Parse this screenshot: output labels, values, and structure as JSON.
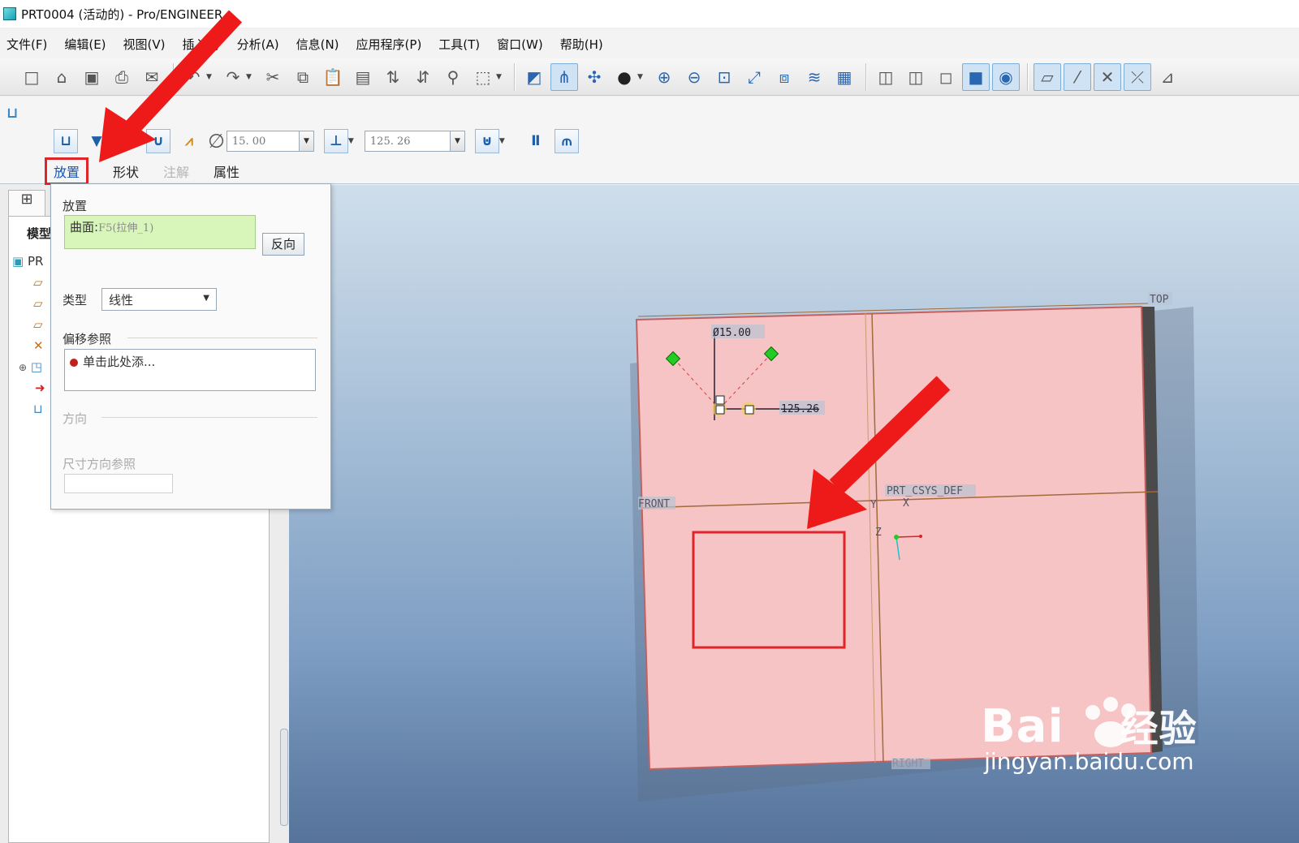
{
  "window": {
    "title": "PRT0004 (活动的) - Pro/ENGINEER"
  },
  "menu": [
    "文件(F)",
    "编辑(E)",
    "视图(V)",
    "插入(I)",
    "分析(A)",
    "信息(N)",
    "应用程序(P)",
    "工具(T)",
    "窗口(W)",
    "帮助(H)"
  ],
  "toolbar": {
    "icons": [
      "new-icon",
      "open-icon",
      "save-icon",
      "print-icon",
      "send-icon",
      "undo-icon",
      "redo-icon",
      "cut-icon",
      "copy-icon",
      "paste-icon",
      "paste-special-icon",
      "regenerate-icon",
      "regen-manager-icon",
      "find-icon",
      "select-box-icon",
      "sketch-display-icon",
      "datum-axis-icon",
      "datum-point-icon",
      "shading-icon",
      "zoom-in-icon",
      "zoom-out-icon",
      "refit-icon",
      "reorient-icon",
      "saved-views-icon",
      "layers-icon",
      "view-manager-icon",
      "wireframe-icon",
      "hidden-line-icon",
      "no-hidden-icon",
      "shaded-icon",
      "enhanced-realism-icon",
      "datum-planes-icon",
      "datum-axes-icon",
      "point-display-icon",
      "csys-display-icon",
      "annotation-display-icon"
    ]
  },
  "dashboard": {
    "diameter": "15. 00",
    "depth": "125. 26",
    "tabs": {
      "placement": "放置",
      "shape": "形状",
      "note": "注解",
      "properties": "属性"
    }
  },
  "placement_panel": {
    "title": "放置",
    "surface_label": "曲面:",
    "surface_ref": "F5(拉伸_1)",
    "flip_button": "反向",
    "type_label": "类型",
    "type_value": "线性",
    "offset_label": "偏移参照",
    "offset_placeholder": "单击此处添...",
    "direction_label": "方向",
    "dim_dir_label": "尺寸方向参照"
  },
  "model_tree": {
    "tab_icon": "model-tree-icon",
    "header": "模型",
    "root": "PR"
  },
  "viewport": {
    "top_label": "TOP",
    "front_label": "FRONT",
    "right_label": "RIGHT",
    "csys_label": "PRT_CSYS_DEF",
    "dim_diameter": "Ø15.00",
    "dim_depth": "125.26",
    "axis_y": "Y",
    "axis_x": "X",
    "axis_z": "Z"
  },
  "watermark": {
    "logo": "Bai",
    "logo_suffix": "经验",
    "url": "jingyan.baidu.com"
  },
  "colors": {
    "part_face": "#f6c4c4",
    "highlight_red": "#e0252a",
    "arrow_red": "#ee1a1a",
    "handle_green": "#22cc22",
    "datum_brown": "#a06a3a"
  }
}
